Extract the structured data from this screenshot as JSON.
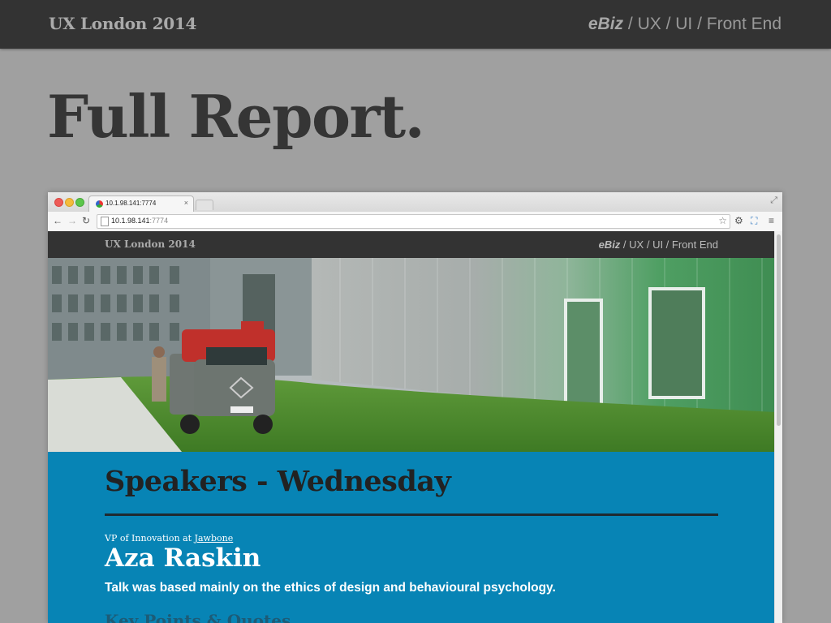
{
  "slide": {
    "brand": "UX London 2014",
    "nav": {
      "ebiz": "eBiz",
      "sep1": " / ",
      "ux": "UX",
      "sep2": " / ",
      "ui": "UI",
      "sep3": " / ",
      "fe": "Front End"
    },
    "title": "Full Report."
  },
  "browser": {
    "tab_title": "10.1.98.141:7774",
    "url_host": "10.1.98.141",
    "url_port": ":7774"
  },
  "site": {
    "brand": "UX London 2014",
    "nav": {
      "ebiz": "eBiz",
      "sep1": " / ",
      "ux": "UX",
      "sep2": " / ",
      "ui": "UI",
      "sep3": " / ",
      "fe": "Front End"
    },
    "section_title": "Speakers - Wednesday",
    "speaker": {
      "role_prefix": "VP of Innovation at ",
      "company": "Jawbone",
      "name": "Aza Raskin",
      "summary": "Talk was based mainly on the ethics of design and behavioural psychology."
    },
    "next_heading": "Key Points & Quotes"
  },
  "colors": {
    "accent": "#0784b5",
    "dark": "#333333",
    "bg": "#a0a0a0"
  }
}
